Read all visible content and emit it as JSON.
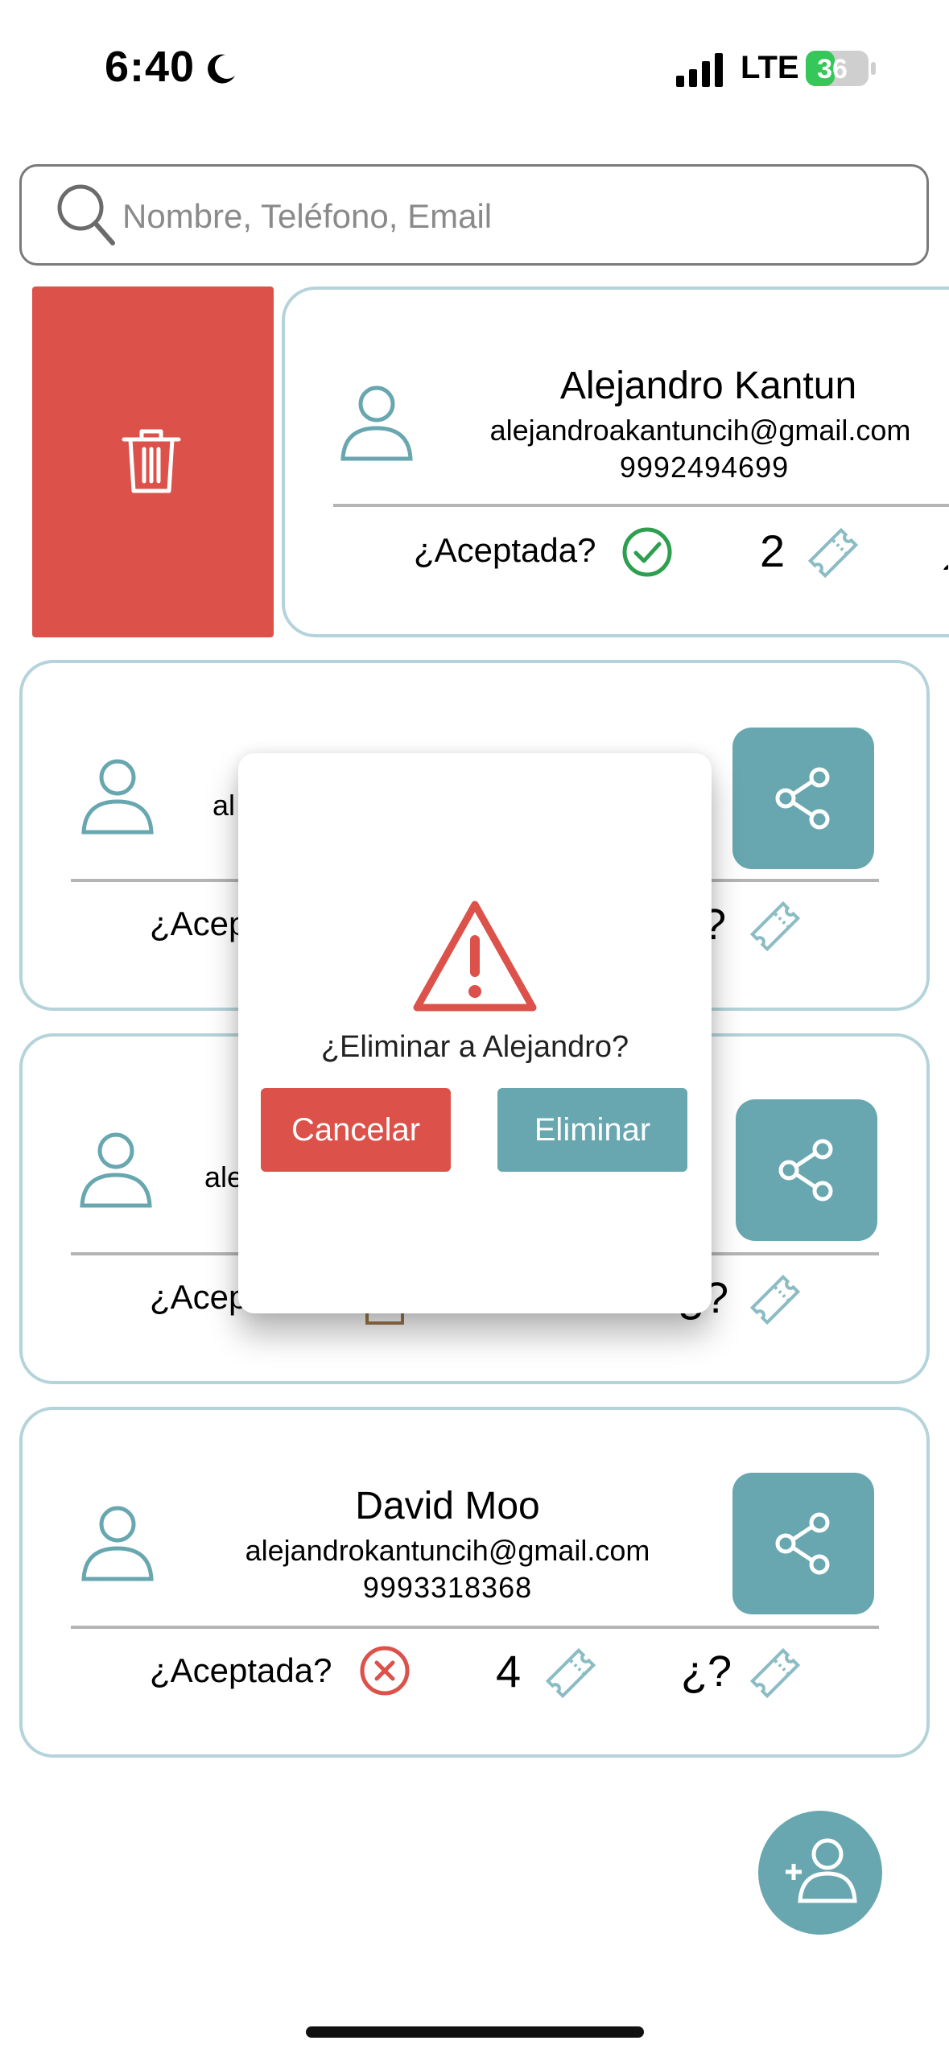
{
  "status_bar": {
    "time": "6:40",
    "network": "LTE",
    "battery": "36"
  },
  "search": {
    "placeholder": "Nombre, Teléfono, Email"
  },
  "colors": {
    "accent": "#68a7b0",
    "danger": "#dc5149",
    "success": "#2e9e4f",
    "card_border": "#b4d3da",
    "pending": "#a0784a"
  },
  "cards": [
    {
      "name": "Alejandro Kantun",
      "email": "alejandroakantuncih@gmail.com",
      "phone": "9992494699",
      "accepted_label": "¿Aceptada?",
      "accepted": "yes",
      "tickets": "2"
    },
    {
      "email_partial": "al",
      "accepted_label": "¿Acep",
      "unknown": "?"
    },
    {
      "email_partial": "ale",
      "accepted_label": "¿Acep",
      "unknown": "¿?"
    },
    {
      "name": "David Moo",
      "email": "alejandrokantuncih@gmail.com",
      "phone": "9993318368",
      "accepted_label": "¿Aceptada?",
      "accepted": "no",
      "tickets": "4",
      "unknown": "¿?"
    }
  ],
  "modal": {
    "message": "¿Eliminar a Alejandro?",
    "cancel_label": "Cancelar",
    "confirm_label": "Eliminar"
  },
  "icons": {
    "delete": "trash-icon",
    "share": "share-icon",
    "add_contact": "person-add-icon",
    "ticket": "ticket-icon",
    "warning": "warning-icon"
  }
}
